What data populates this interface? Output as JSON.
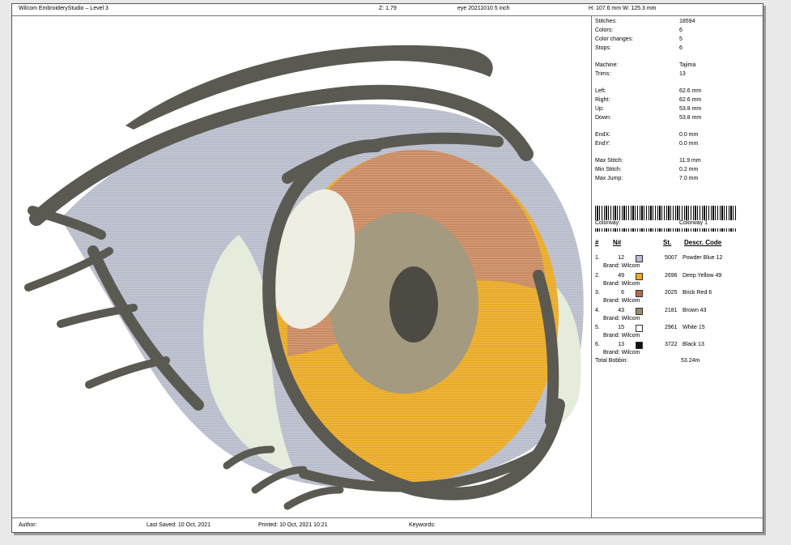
{
  "header": {
    "title": "Wilcom EmbroideryStudio – Level 3",
    "zoom": "Z: 1.79",
    "design": "eye 20211010 5 inch",
    "dimensions": "H: 107.6 mm   W: 125.3 mm"
  },
  "stats": [
    {
      "label": "Stitches:",
      "value": "18594"
    },
    {
      "label": "Colors:",
      "value": "6"
    },
    {
      "label": "Color changes:",
      "value": "5"
    },
    {
      "label": "Stops:",
      "value": "6"
    },
    {
      "label": "Machine:",
      "value": "Tajima"
    },
    {
      "label": "Trims:",
      "value": "13"
    },
    {
      "label": "Left:",
      "value": "62.6 mm"
    },
    {
      "label": "Right:",
      "value": "62.6 mm"
    },
    {
      "label": "Up:",
      "value": "53.8 mm"
    },
    {
      "label": "Down:",
      "value": "53.8 mm"
    },
    {
      "label": "EndX:",
      "value": "0.0 mm"
    },
    {
      "label": "EndY:",
      "value": "0.0 mm"
    },
    {
      "label": "Max Stitch:",
      "value": "11.9 mm"
    },
    {
      "label": "Min Stitch:",
      "value": "0.2 mm"
    },
    {
      "label": "Max Jump:",
      "value": "7.0 mm"
    }
  ],
  "colorway": {
    "label": "Colorway:",
    "value": "Colorway 1"
  },
  "color_table": {
    "headers": {
      "index": "#",
      "number": "N#",
      "stitches": "St.",
      "desc": "Descr. Code"
    },
    "rows": [
      {
        "index": "1.",
        "number": "12",
        "color": "#b8bcd8",
        "stitches": "5007",
        "desc": "Powder Blue 12",
        "brand": "Brand: Wilcom"
      },
      {
        "index": "2.",
        "number": "49",
        "color": "#f0a820",
        "stitches": "2696",
        "desc": "Deep Yellow 49",
        "brand": "Brand: Wilcom"
      },
      {
        "index": "3.",
        "number": "6",
        "color": "#b86a4a",
        "stitches": "2025",
        "desc": "Brick Red 6",
        "brand": "Brand: Wilcom"
      },
      {
        "index": "4.",
        "number": "43",
        "color": "#9a8a70",
        "stitches": "2181",
        "desc": "Brown 43",
        "brand": "Brand: Wilcom"
      },
      {
        "index": "5.",
        "number": "15",
        "color": "#ffffff",
        "stitches": "2961",
        "desc": "White 15",
        "brand": "Brand: Wilcom"
      },
      {
        "index": "6.",
        "number": "13",
        "color": "#111111",
        "stitches": "3722",
        "desc": "Black 13",
        "brand": "Brand: Wilcom"
      }
    ]
  },
  "bobbin": {
    "label": "Total Bobbin:",
    "value": "53.24m"
  },
  "footer": {
    "author": "Author:",
    "saved": "Last Saved: 10 Oct, 2021",
    "printed": "Printed: 10 Oct, 2021 10:21",
    "keywords": "Keywords:"
  },
  "design_colors": {
    "outline": "#5a5a52",
    "sclera": "#b9bccb",
    "sclera_highlight": "#e6ecdc",
    "iris_top": "#c98a62",
    "iris_bottom": "#e9aa26",
    "iris_ring": "#a49a80",
    "pupil": "#4d4a44",
    "catchlight": "#eeeee2"
  }
}
